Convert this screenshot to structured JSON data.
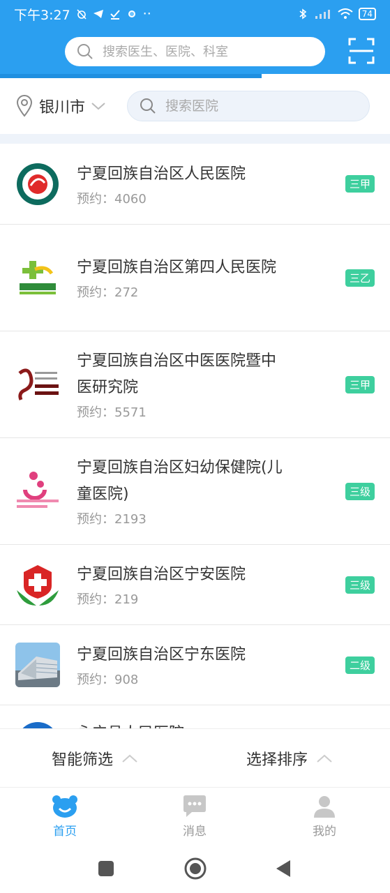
{
  "status_bar": {
    "time": "下午3:27",
    "dots": "··",
    "battery": "74"
  },
  "header": {
    "search_placeholder": "搜索医生、医院、科室"
  },
  "filter": {
    "city": "银川市",
    "hospital_search_placeholder": "搜索医院"
  },
  "appointment_label": "预约：",
  "hospitals": [
    {
      "name": "宁夏回族自治区人民医院",
      "appointments": "4060",
      "grade": "三甲",
      "logo": "hospital-logo-red-circle"
    },
    {
      "name": "宁夏回族自治区第四人民医院",
      "appointments": "272",
      "grade": "三乙",
      "logo": "hospital-logo-green-cross"
    },
    {
      "name": "宁夏回族自治区中医医院暨中医研究院",
      "appointments": "5571",
      "grade": "三甲",
      "logo": "hospital-logo-tcm"
    },
    {
      "name": "宁夏回族自治区妇幼保健院(儿童医院)",
      "appointments": "2193",
      "grade": "三级",
      "logo": "hospital-logo-maternal"
    },
    {
      "name": "宁夏回族自治区宁安医院",
      "appointments": "219",
      "grade": "三级",
      "logo": "hospital-logo-red-cross-leaves"
    },
    {
      "name": "宁夏回族自治区宁东医院",
      "appointments": "908",
      "grade": "二级",
      "logo": "hospital-building-photo"
    },
    {
      "name": "永宁县人民医院",
      "appointments": "",
      "grade": "",
      "logo": "hospital-logo-blue"
    }
  ],
  "bottom_filter": {
    "smart_filter": "智能筛选",
    "sort": "选择排序"
  },
  "tabs": [
    {
      "label": "首页",
      "icon": "home-bear-icon",
      "active": true
    },
    {
      "label": "消息",
      "icon": "message-icon",
      "active": false
    },
    {
      "label": "我的",
      "icon": "profile-icon",
      "active": false
    }
  ],
  "colors": {
    "primary": "#2b9ff0",
    "grade_badge": "#3ecf9e"
  }
}
